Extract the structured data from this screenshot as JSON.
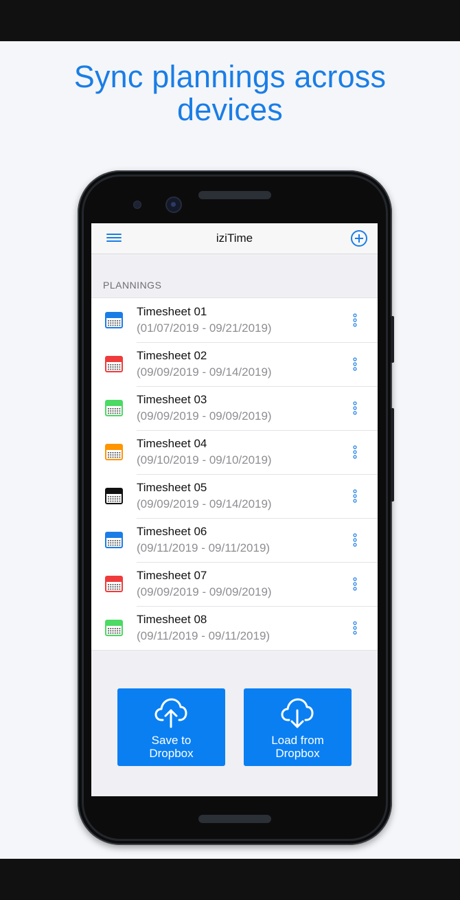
{
  "promo": {
    "headline": "Sync plannings across\ndevices"
  },
  "app": {
    "title": "iziTime",
    "menu_icon": "hamburger-menu-icon",
    "add_icon": "plus-circle-icon",
    "section_label": "PLANNINGS",
    "plannings": [
      {
        "name": "Timesheet 01",
        "dates": "(01/07/2019 - 09/21/2019)",
        "color": "#1a7de6"
      },
      {
        "name": "Timesheet 02",
        "dates": "(09/09/2019 - 09/14/2019)",
        "color": "#ef3b3b"
      },
      {
        "name": "Timesheet 03",
        "dates": "(09/09/2019 - 09/09/2019)",
        "color": "#4cd964"
      },
      {
        "name": "Timesheet 04",
        "dates": "(09/10/2019 - 09/10/2019)",
        "color": "#ff9500"
      },
      {
        "name": "Timesheet 05",
        "dates": "(09/09/2019 - 09/14/2019)",
        "color": "#111111"
      },
      {
        "name": "Timesheet 06",
        "dates": "(09/11/2019 - 09/11/2019)",
        "color": "#1a7de6"
      },
      {
        "name": "Timesheet 07",
        "dates": "(09/09/2019 - 09/09/2019)",
        "color": "#ef3b3b"
      },
      {
        "name": "Timesheet 08",
        "dates": "(09/11/2019 - 09/11/2019)",
        "color": "#4cd964"
      }
    ],
    "actions": {
      "save": {
        "label": "Save to\nDropbox",
        "icon": "cloud-upload-icon"
      },
      "load": {
        "label": "Load from\nDropbox",
        "icon": "cloud-download-icon"
      }
    },
    "colors": {
      "accent": "#1a7de6",
      "button": "#0a7ff2"
    }
  }
}
